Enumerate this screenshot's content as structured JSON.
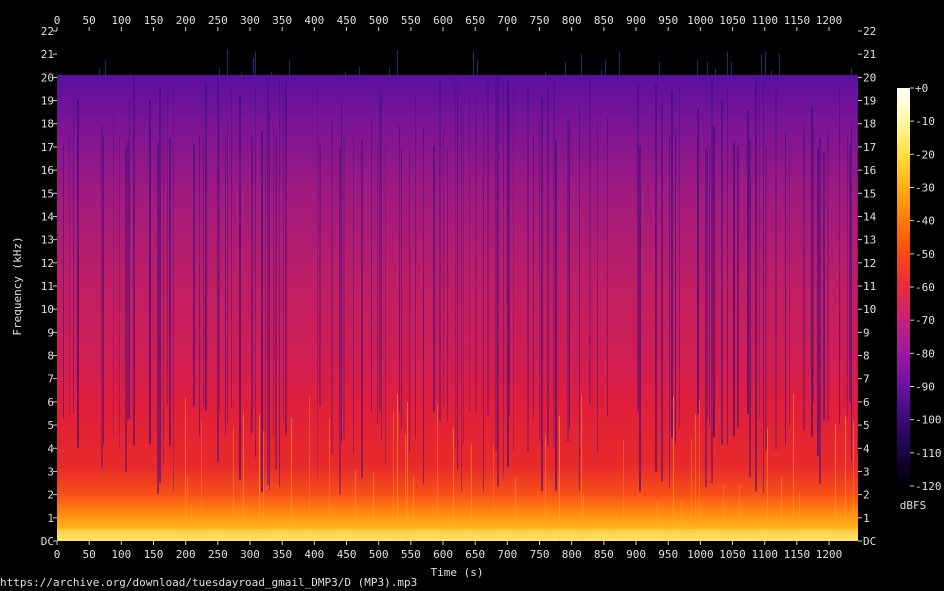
{
  "chart_data": {
    "type": "heatmap",
    "xlabel": "Time (s)",
    "ylabel": "Frequency (kHz)",
    "x_ticks": [
      0,
      50,
      100,
      150,
      200,
      250,
      300,
      350,
      400,
      450,
      500,
      550,
      600,
      650,
      700,
      750,
      800,
      850,
      900,
      950,
      1000,
      1050,
      1100,
      1150,
      1200
    ],
    "y_ticks": [
      "DC",
      "1",
      "2",
      "3",
      "4",
      "5",
      "6",
      "7",
      "8",
      "9",
      "10",
      "11",
      "12",
      "13",
      "14",
      "15",
      "16",
      "17",
      "18",
      "19",
      "20",
      "21",
      "22"
    ],
    "xlim": [
      0,
      1245
    ],
    "ylim": [
      0,
      22
    ],
    "lowpass_cutoff_khz": 20.1,
    "colorbar": {
      "label": "dBFS",
      "ticks": [
        "+0",
        "-10",
        "-20",
        "-30",
        "-40",
        "-50",
        "-60",
        "-70",
        "-80",
        "-90",
        "-100",
        "-110",
        "-120"
      ],
      "range": [
        -120,
        0
      ],
      "colors": [
        "#000000",
        "#180444",
        "#3c0a78",
        "#6a12a0",
        "#9a1aa0",
        "#c8207a",
        "#e82a40",
        "#f84a14",
        "#ff7a08",
        "#ffb010",
        "#ffe040",
        "#fff8a0",
        "#ffffff"
      ]
    },
    "energy_profile": [
      {
        "freq_khz": 0.3,
        "dbfs": -22
      },
      {
        "freq_khz": 1,
        "dbfs": -30
      },
      {
        "freq_khz": 2,
        "dbfs": -38
      },
      {
        "freq_khz": 3,
        "dbfs": -46
      },
      {
        "freq_khz": 4,
        "dbfs": -52
      },
      {
        "freq_khz": 6,
        "dbfs": -57
      },
      {
        "freq_khz": 8,
        "dbfs": -60
      },
      {
        "freq_khz": 10,
        "dbfs": -66
      },
      {
        "freq_khz": 13,
        "dbfs": -69
      },
      {
        "freq_khz": 16,
        "dbfs": -73
      },
      {
        "freq_khz": 19,
        "dbfs": -77
      },
      {
        "freq_khz": 20,
        "dbfs": -82
      }
    ]
  },
  "source_url": "https://archive.org/download/tuesdayroad_gmail_DMP3/D (MP3).mp3"
}
